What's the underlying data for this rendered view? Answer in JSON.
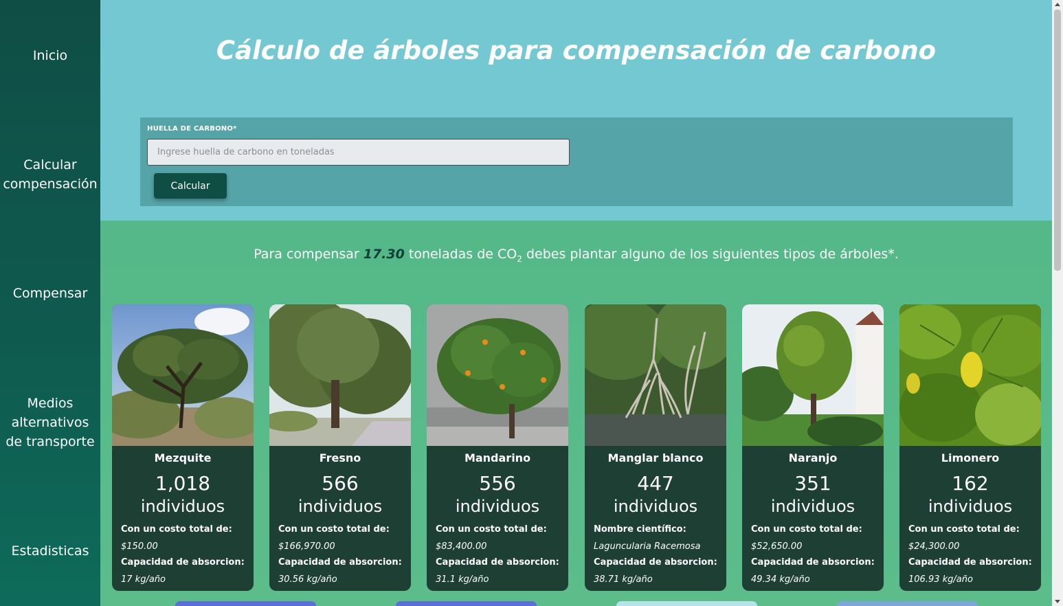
{
  "nav": {
    "items": [
      {
        "label": "Inicio"
      },
      {
        "label": "Calcular compensación"
      },
      {
        "label": "Compensar"
      },
      {
        "label": "Medios alternativos de transporte"
      },
      {
        "label": "Estadisticas"
      }
    ]
  },
  "header": {
    "title": "Cálculo de árboles para compensación de carbono"
  },
  "form": {
    "label": "HUELLA DE CARBONO*",
    "placeholder": "Ingrese huella de carbono en toneladas",
    "value": "",
    "button_label": "Calcular"
  },
  "summary": {
    "prefix": "Para compensar",
    "amount": "17.30",
    "middle": "toneladas de CO",
    "subscript": "2",
    "suffix": "debes plantar alguno de los siguientes tipos de árboles*."
  },
  "trees": [
    {
      "name": "Mezquite",
      "count": "1,018",
      "unit": "individuos",
      "label1": "Con un costo total de:",
      "value1": "$150.00",
      "label2": "Capacidad de absorcion:",
      "value2": "17 kg/año"
    },
    {
      "name": "Fresno",
      "count": "566",
      "unit": "individuos",
      "label1": "Con un costo total de:",
      "value1": "$166,970.00",
      "label2": "Capacidad de absorcion:",
      "value2": "30.56 kg/año"
    },
    {
      "name": "Mandarino",
      "count": "556",
      "unit": "individuos",
      "label1": "Con un costo total de:",
      "value1": "$83,400.00",
      "label2": "Capacidad de absorcion:",
      "value2": "31.1 kg/año"
    },
    {
      "name": "Manglar blanco",
      "count": "447",
      "unit": "individuos",
      "label1": "Nombre científico:",
      "value1": "Laguncularia Racemosa",
      "label2": "Capacidad de absorcion:",
      "value2": "38.71 kg/año"
    },
    {
      "name": "Naranjo",
      "count": "351",
      "unit": "individuos",
      "label1": "Con un costo total de:",
      "value1": "$52,650.00",
      "label2": "Capacidad de absorcion:",
      "value2": "49.34 kg/año"
    },
    {
      "name": "Limonero",
      "count": "162",
      "unit": "individuos",
      "label1": "Con un costo total de:",
      "value1": "$24,300.00",
      "label2": "Capacidad de absorcion:",
      "value2": "106.93 kg/año"
    }
  ],
  "colors": {
    "sidebar": "#0f4e45",
    "header_bg": "#74c8d2",
    "form_panel": "#55a4a7",
    "results_bg": "#5cbd8b",
    "card_bg": "#1e3f33",
    "accent_dark": "#0e4e45"
  }
}
